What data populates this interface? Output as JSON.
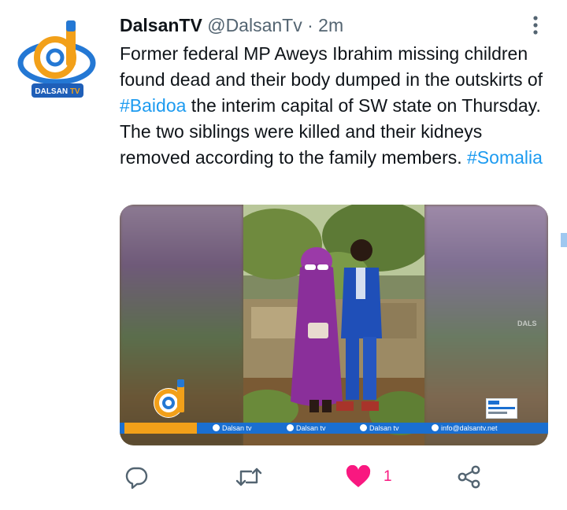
{
  "tweet": {
    "display_name": "DalsanTV",
    "handle": "@DalsanTv",
    "separator": "·",
    "time": "2m",
    "text_before": "Former federal MP Aweys Ibrahim missing children found dead and their body dumped in the outskirts of ",
    "hashtag_1": "#Baidoa",
    "text_middle": " the interim capital of SW state on Thursday. The two siblings were killed and their kidneys removed according to the family members.  ",
    "hashtag_2": "#Somalia"
  },
  "avatar": {
    "logo_text": "DALSAN TV"
  },
  "media": {
    "watermark": "DALS",
    "bar_items": [
      {
        "icon": "facebook-icon",
        "label": "Dalsan tv"
      },
      {
        "icon": "twitter-icon",
        "label": "Dalsan tv"
      },
      {
        "icon": "instagram-icon",
        "label": "Dalsan tv"
      },
      {
        "icon": "email-icon",
        "label": "info@dalsantv.net"
      }
    ]
  },
  "actions": {
    "reply_icon": "reply-icon",
    "retweet_icon": "retweet-icon",
    "like_icon": "heart-icon",
    "like_count": "1",
    "share_icon": "share-icon"
  },
  "colors": {
    "link": "#1d9bf0",
    "secondary_text": "#536471",
    "icon_gray": "#536471",
    "like_pink": "#f91880",
    "brand_blue": "#1a6fd1",
    "brand_orange": "#f2a019"
  }
}
